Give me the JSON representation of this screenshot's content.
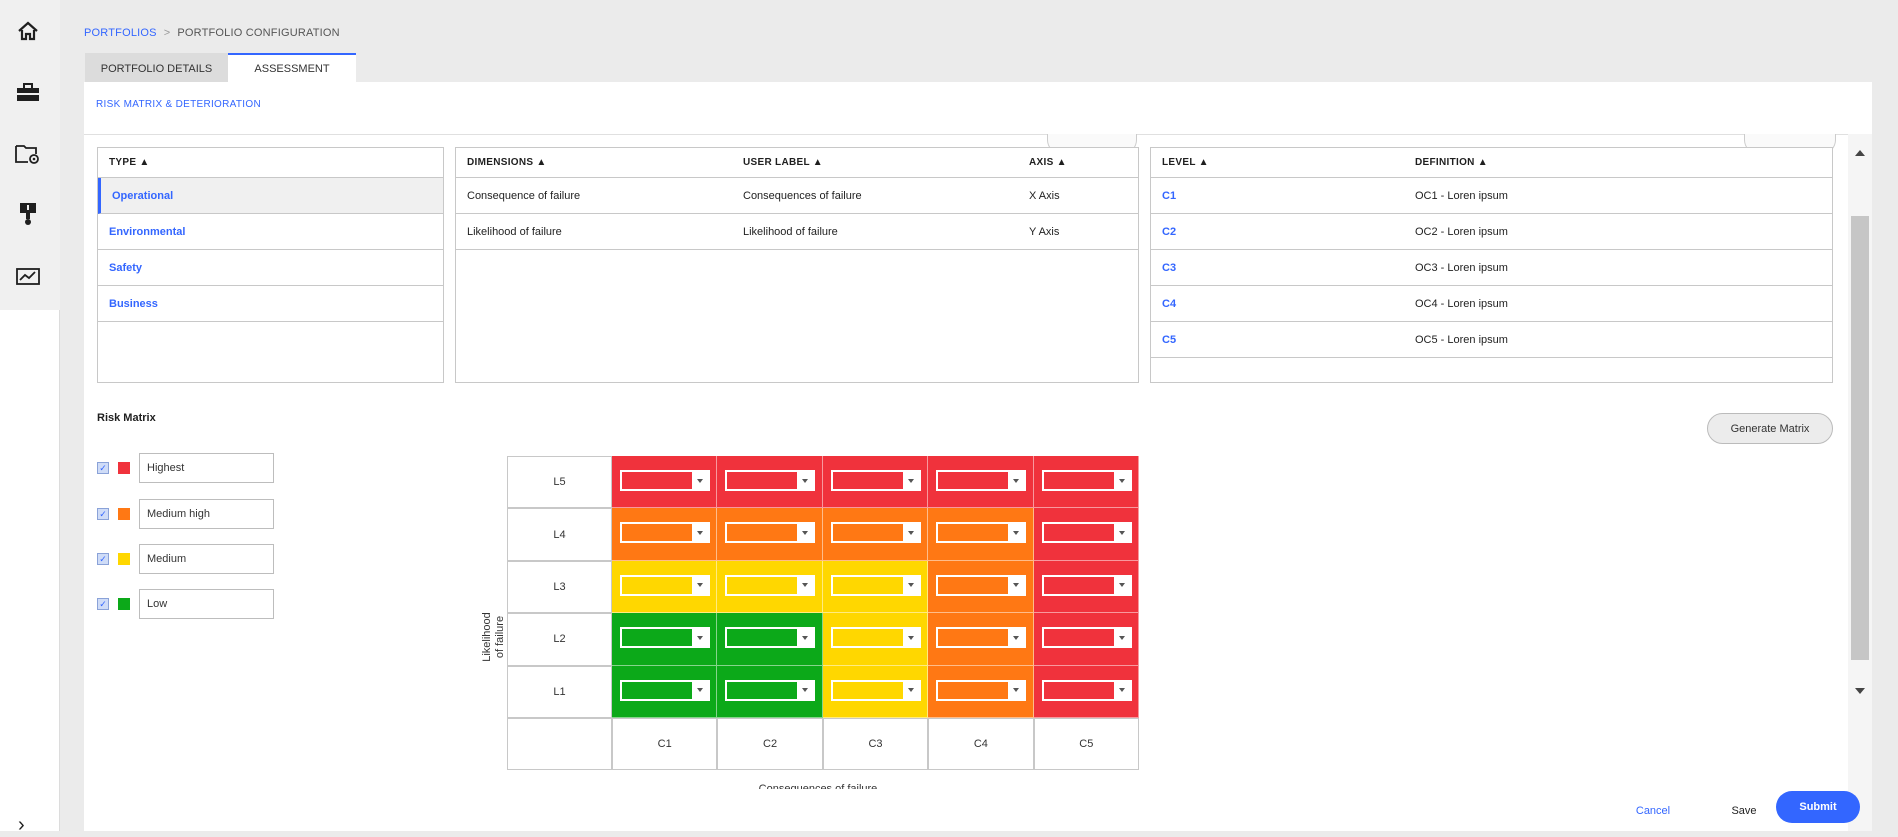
{
  "sidebar": {
    "icons": [
      "home-icon",
      "briefcase-icon",
      "folder-settings-icon",
      "asset-alert-icon",
      "analytics-monitor-icon"
    ],
    "expand_icon": "chevron-right-icon"
  },
  "breadcrumb": {
    "portfolios": "PORTFOLIOS",
    "separator": ">",
    "current": "PORTFOLIO CONFIGURATION"
  },
  "tabs": [
    {
      "label": "PORTFOLIO DETAILS",
      "active": false
    },
    {
      "label": "ASSESSMENT",
      "active": true
    }
  ],
  "section_title": "RISK MATRIX & DETERIORATION",
  "type_table": {
    "header": "TYPE ▲",
    "rows": [
      "Operational",
      "Environmental",
      "Safety",
      "Business"
    ]
  },
  "dimensions_table": {
    "headers": {
      "dimensions": "DIMENSIONS ▲",
      "user_label": "USER LABEL ▲",
      "axis": "AXIS ▲"
    },
    "rows": [
      {
        "dimension": "Consequence of failure",
        "user_label": "Consequences of failure",
        "axis": "X Axis"
      },
      {
        "dimension": "Likelihood of failure",
        "user_label": "Likelihood of failure",
        "axis": "Y Axis"
      }
    ]
  },
  "level_table": {
    "headers": {
      "level": "LEVEL ▲",
      "definition": "DEFINITION ▲"
    },
    "rows": [
      {
        "level": "C1",
        "definition": "OC1 - Loren ipsum"
      },
      {
        "level": "C2",
        "definition": "OC2 - Loren ipsum"
      },
      {
        "level": "C3",
        "definition": "OC3 - Loren ipsum"
      },
      {
        "level": "C4",
        "definition": "OC4 - Loren ipsum"
      },
      {
        "level": "C5",
        "definition": "OC5 - Loren ipsum"
      }
    ]
  },
  "risk_matrix": {
    "title": "Risk Matrix",
    "generate_button": "Generate Matrix",
    "legend": [
      {
        "label": "Highest",
        "color": "#f0323c",
        "checked": true
      },
      {
        "label": "Medium high",
        "color": "#ff7814",
        "checked": true
      },
      {
        "label": "Medium",
        "color": "#ffd700",
        "checked": true
      },
      {
        "label": "Low",
        "color": "#0ca919",
        "checked": true
      }
    ],
    "y_axis_label": "Likelihood of failure",
    "x_axis_label": "Consequences of failure",
    "rows": [
      "L5",
      "L4",
      "L3",
      "L2",
      "L1"
    ],
    "columns": [
      "C1",
      "C2",
      "C3",
      "C4",
      "C5"
    ],
    "cells": [
      [
        "Highest",
        "Highest",
        "Highest",
        "Highest",
        "Highest"
      ],
      [
        "Medium high",
        "Medium high",
        "Medium high",
        "Medium high",
        "Highest"
      ],
      [
        "Medium",
        "Medium",
        "Medium",
        "Medium high",
        "Highest"
      ],
      [
        "Low",
        "Low",
        "Medium",
        "Medium high",
        "Highest"
      ],
      [
        "Low",
        "Low",
        "Medium",
        "Medium high",
        "Highest"
      ]
    ]
  },
  "footer": {
    "cancel": "Cancel",
    "save": "Save",
    "submit": "Submit"
  }
}
